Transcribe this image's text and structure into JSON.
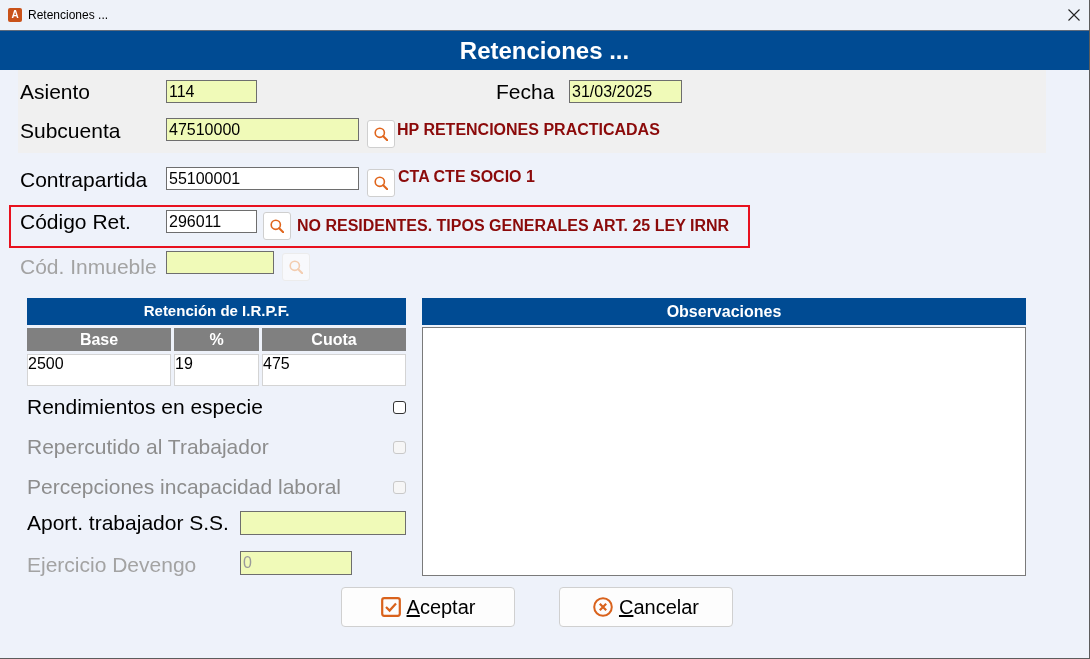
{
  "window": {
    "title": "Retenciones ...",
    "icon_letter": "A"
  },
  "banner": {
    "title": "Retenciones ..."
  },
  "entry": {
    "asiento": {
      "label": "Asiento",
      "value": "114",
      "tinted": true
    },
    "fecha": {
      "label": "Fecha",
      "value": "31/03/2025",
      "tinted": true
    },
    "subcuenta": {
      "label": "Subcuenta",
      "value": "47510000",
      "tinted": true,
      "description": "HP RETENCIONES PRACTICADAS"
    }
  },
  "contrapartida": {
    "label": "Contrapartida",
    "value": "55100001",
    "tinted": false,
    "description": "CTA CTE SOCIO 1"
  },
  "codigo_ret": {
    "label": "Código Ret.",
    "value": "296011",
    "tinted": false,
    "description": "NO RESIDENTES. TIPOS GENERALES ART. 25 LEY IRNR",
    "outlined": true
  },
  "cod_inmueble": {
    "label": "Cód. Inmueble",
    "tinted": true,
    "disabled": true
  },
  "irpf": {
    "title": "Retención de I.R.P.F.",
    "columns": [
      {
        "label": "Base",
        "value": "2500"
      },
      {
        "label": "%",
        "value": "19"
      },
      {
        "label": "Cuota",
        "value": "475"
      }
    ]
  },
  "options": [
    {
      "label": "Rendimientos en especie",
      "checked": false,
      "disabled": false
    },
    {
      "label": "Repercutido al Trabajador",
      "checked": false,
      "disabled": true
    },
    {
      "label": "Percepciones incapacidad laboral",
      "checked": false,
      "disabled": true
    }
  ],
  "aport": {
    "label": "Aport. trabajador S.S.",
    "tinted": true,
    "disabled": false
  },
  "ejercicio": {
    "label": "Ejercicio Devengo",
    "value": "0",
    "tinted": true,
    "disabled": true
  },
  "observaciones": {
    "title": "Observaciones"
  },
  "buttons": [
    {
      "label": "Aceptar",
      "kind": "accept",
      "underline_first": true
    },
    {
      "label": "Cancelar",
      "kind": "cancel",
      "underline_first": true
    }
  ]
}
